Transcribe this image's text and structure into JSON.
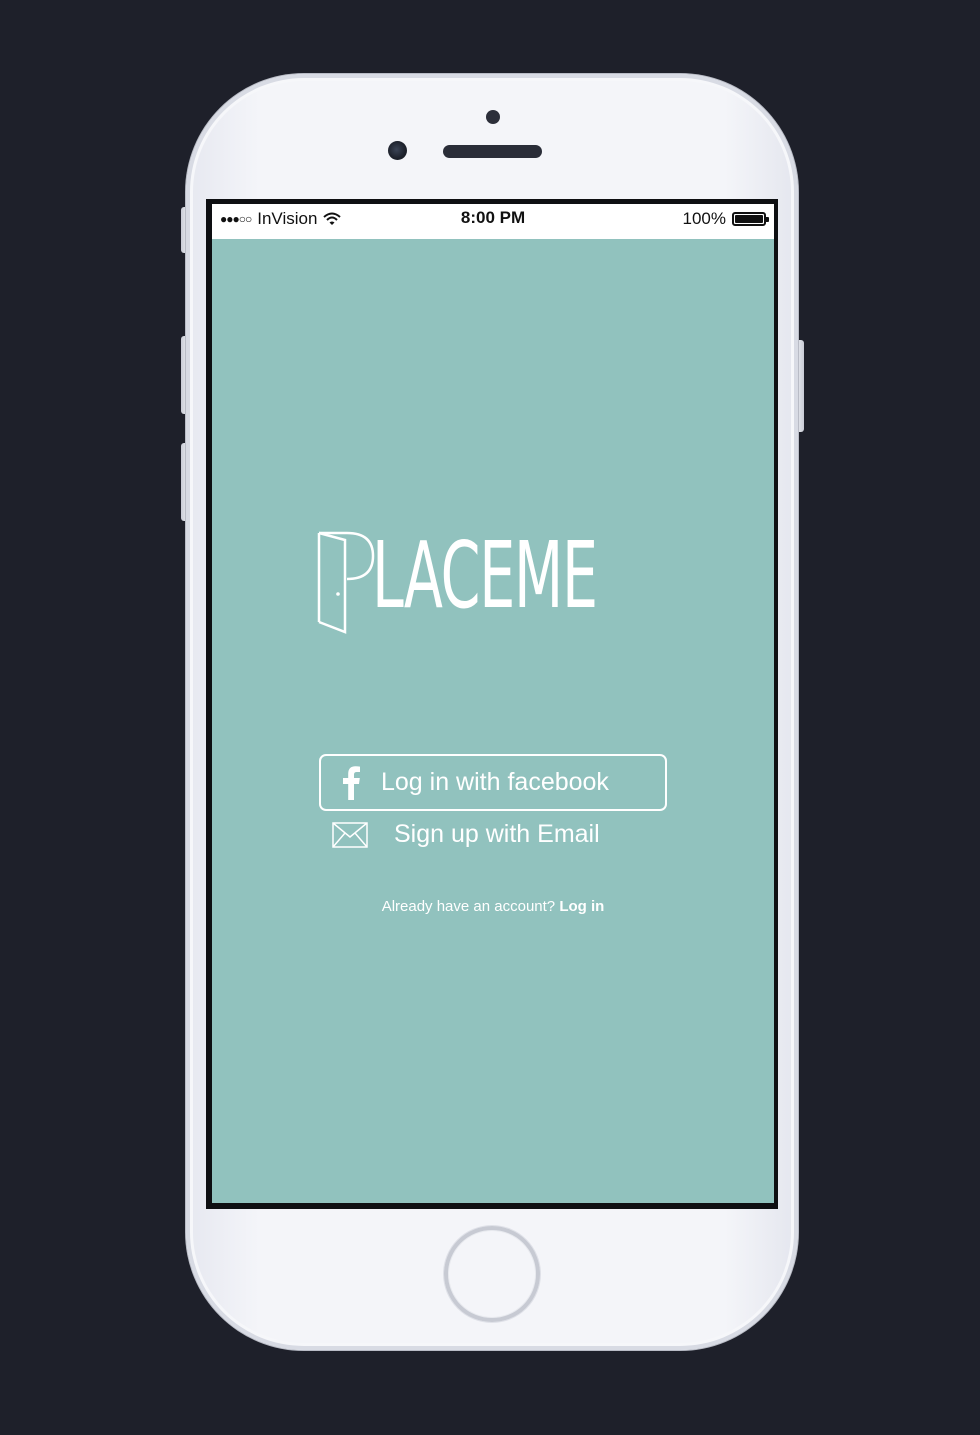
{
  "status_bar": {
    "signal": "●●●○○",
    "carrier": "InVision",
    "time": "8:00 PM",
    "battery_percent": "100%",
    "battery_level": 1.0
  },
  "app": {
    "logo_text": "LACEME",
    "logo_mark": "door-p-logo",
    "background_color": "#91c2be"
  },
  "buttons": {
    "facebook_label": "Log in with facebook",
    "email_label": "Sign up with Email"
  },
  "footer": {
    "prompt": "Already have an account?",
    "login_link": "Log in"
  },
  "icons": {
    "facebook": "facebook-icon",
    "email": "envelope-icon",
    "wifi": "wifi-icon",
    "battery": "battery-icon"
  }
}
